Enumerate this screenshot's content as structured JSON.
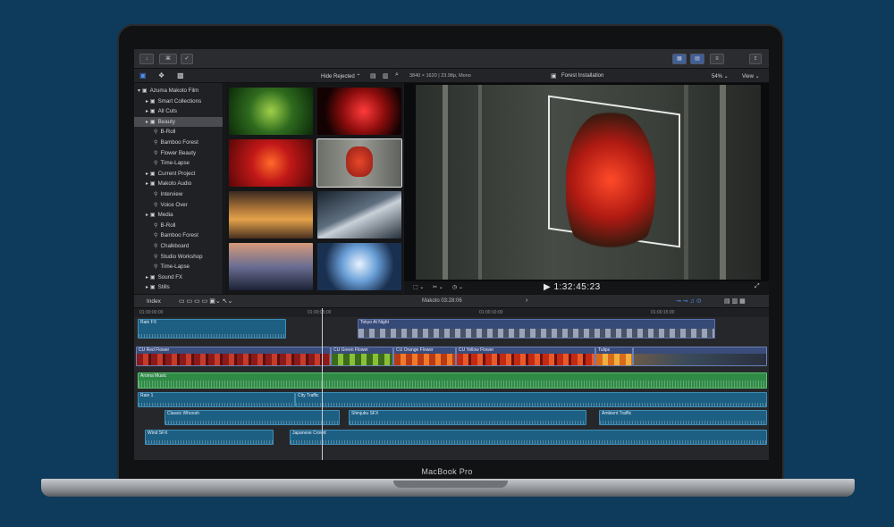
{
  "device": {
    "label": "MacBook Pro"
  },
  "topbar": {
    "btn_keyword": "⌘",
    "btn_check": "✓"
  },
  "browser_toolbar": {
    "filter": "Hide Rejected ⌃"
  },
  "viewer_header": {
    "format": "3840 × 1620 | 23.98p, Mono",
    "clip_name": "Forest Installation",
    "zoom": "54% ⌄",
    "view": "View ⌄"
  },
  "sidebar": {
    "items": [
      {
        "label": "Azuma Makoto Film",
        "level": 0,
        "kind": "library"
      },
      {
        "label": "Smart Collections",
        "level": 1,
        "kind": "folder"
      },
      {
        "label": "All Cuts",
        "level": 1,
        "kind": "folder"
      },
      {
        "label": "Beauty",
        "level": 1,
        "kind": "event",
        "selected": true
      },
      {
        "label": "B-Roll",
        "level": 2,
        "kind": "keyword"
      },
      {
        "label": "Bamboo Forest",
        "level": 2,
        "kind": "keyword"
      },
      {
        "label": "Flower Beauty",
        "level": 2,
        "kind": "keyword"
      },
      {
        "label": "Time-Lapse",
        "level": 2,
        "kind": "keyword"
      },
      {
        "label": "Current Project",
        "level": 1,
        "kind": "event"
      },
      {
        "label": "Makoto Audio",
        "level": 1,
        "kind": "event"
      },
      {
        "label": "Interview",
        "level": 2,
        "kind": "keyword"
      },
      {
        "label": "Voice Over",
        "level": 2,
        "kind": "keyword"
      },
      {
        "label": "Media",
        "level": 1,
        "kind": "event"
      },
      {
        "label": "B-Roll",
        "level": 2,
        "kind": "keyword"
      },
      {
        "label": "Bamboo Forest",
        "level": 2,
        "kind": "keyword"
      },
      {
        "label": "Chalkboard",
        "level": 2,
        "kind": "keyword"
      },
      {
        "label": "Studio Workshop",
        "level": 2,
        "kind": "keyword"
      },
      {
        "label": "Time-Lapse",
        "level": 2,
        "kind": "keyword"
      },
      {
        "label": "Sound FX",
        "level": 1,
        "kind": "event"
      },
      {
        "label": "Stills",
        "level": 1,
        "kind": "event"
      }
    ]
  },
  "viewer": {
    "timecode": "▶ 1:32:45:23"
  },
  "timeline_bar": {
    "index_label": "Index",
    "project": "Makoto  03:28:06"
  },
  "ruler": {
    "ticks": [
      "01:00:00:00",
      "01:00:05:00",
      "01:00:10:00",
      "01:00:15:00"
    ]
  },
  "clips": {
    "rain_fx": "Rain FX",
    "tokyo_night": "Tokyo At Night",
    "cu_red": "CU Red Flower",
    "cu_green": "CU Green Flower",
    "cu_orange": "CU Orange Flower",
    "cu_yellow": "CU Yellow Flower",
    "tulips": "Tulips",
    "aroma": "Aroma Music",
    "rain1": "Rain 1",
    "city_traffic": "City Traffic",
    "classic_whoosh": "Classic Whoosh",
    "shinjuku": "Shinjuku SFX",
    "ambient": "Ambient Traffic",
    "wind": "Wind SFX",
    "crowd": "Japanese Crowd"
  },
  "colors": {
    "background": "#0e3a5c",
    "audio": "#1d5f82",
    "music": "#2f8a45",
    "video": "#3a4c7a"
  }
}
